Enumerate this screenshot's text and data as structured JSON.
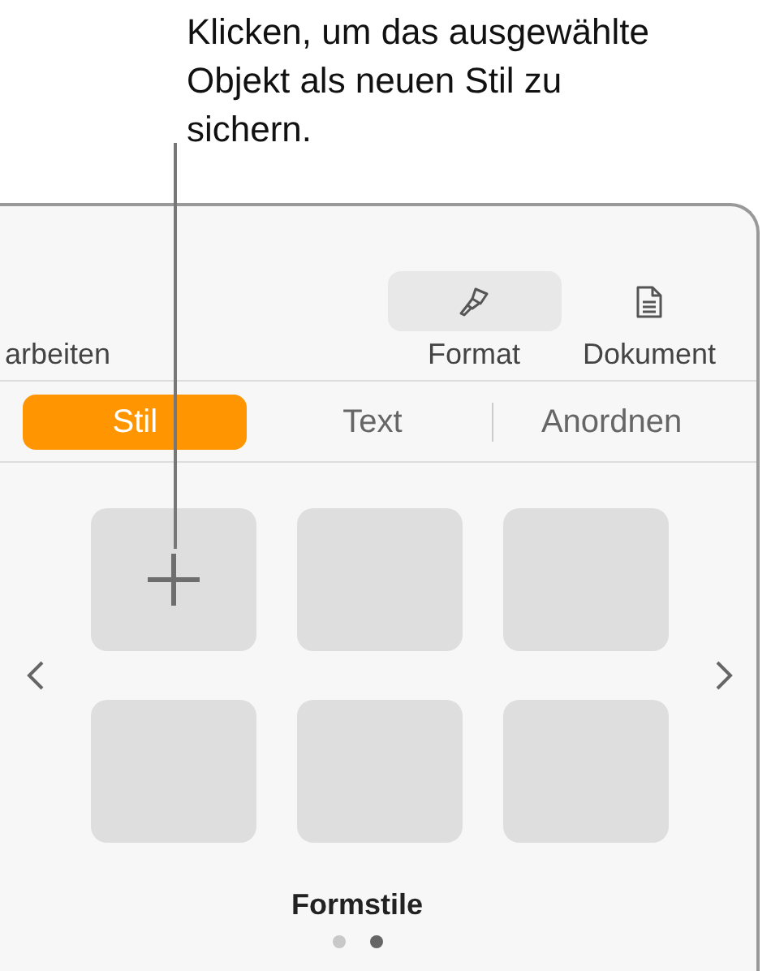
{
  "callout": {
    "text": "Klicken, um das ausgewählte Objekt als neuen Stil zu sichern."
  },
  "toolbar": {
    "edit_label": "arbeiten",
    "buttons": [
      {
        "label": "Format",
        "kind": "brush",
        "selected": true
      },
      {
        "label": "Dokument",
        "kind": "document",
        "selected": false
      }
    ]
  },
  "tabs": [
    {
      "label": "Stil",
      "selected": true
    },
    {
      "label": "Text",
      "selected": false
    },
    {
      "label": "Anordnen",
      "selected": false
    }
  ],
  "styles": [
    {
      "kind": "add"
    },
    {
      "kind": "empty"
    },
    {
      "kind": "empty"
    },
    {
      "kind": "empty"
    },
    {
      "kind": "empty"
    },
    {
      "kind": "empty"
    }
  ],
  "section_label": "Formstile",
  "page_dots": [
    {
      "selected": false
    },
    {
      "selected": true
    }
  ]
}
